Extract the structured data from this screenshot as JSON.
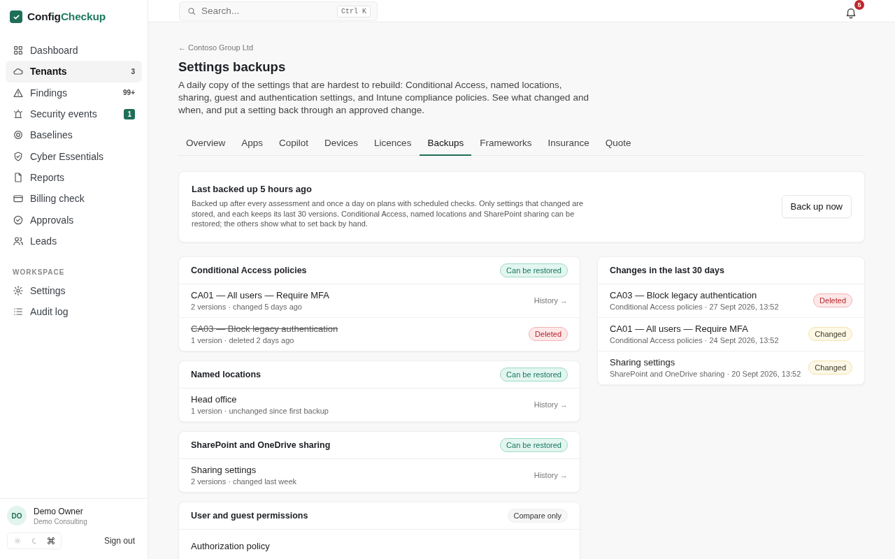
{
  "brand": {
    "first": "Config",
    "second": "Checkup"
  },
  "sidebar": {
    "items": [
      {
        "label": "Dashboard",
        "selected": false
      },
      {
        "label": "Tenants",
        "selected": true,
        "count": {
          "text": "3",
          "kind": "plain"
        }
      },
      {
        "label": "Findings",
        "selected": false,
        "count": {
          "text": "99+",
          "kind": "plain"
        }
      },
      {
        "label": "Security events",
        "selected": false,
        "count": {
          "text": "1",
          "kind": "accent"
        }
      },
      {
        "label": "Baselines",
        "selected": false
      },
      {
        "label": "Cyber Essentials",
        "selected": false
      },
      {
        "label": "Reports",
        "selected": false
      },
      {
        "label": "Billing check",
        "selected": false
      },
      {
        "label": "Approvals",
        "selected": false
      },
      {
        "label": "Leads",
        "selected": false
      }
    ],
    "section_title": "WORKSPACE",
    "workspace_items": [
      {
        "label": "Settings",
        "selected": false
      },
      {
        "label": "Audit log",
        "selected": false
      }
    ],
    "user": {
      "initials": "DO",
      "name": "Demo Owner",
      "org": "Demo Consulting"
    },
    "theme_options": [
      {
        "selected": false
      },
      {
        "selected": false
      },
      {
        "selected": true
      }
    ],
    "sign_out": "Sign out"
  },
  "topbar": {
    "search": {
      "placeholder": "Search...",
      "shortcut": "Ctrl K"
    },
    "notifications": "5"
  },
  "breadcrumb": "← Contoso Group Ltd",
  "title": "Settings backups",
  "description": "A daily copy of the settings that are hardest to rebuild: Conditional Access, named locations, sharing, guest and authentication settings, and Intune compliance policies. See what changed and when, and put a setting back through an approved change.",
  "tabs": [
    {
      "label": "Overview",
      "selected": false
    },
    {
      "label": "Apps",
      "selected": false
    },
    {
      "label": "Copilot",
      "selected": false
    },
    {
      "label": "Devices",
      "selected": false
    },
    {
      "label": "Licences",
      "selected": false
    },
    {
      "label": "Backups",
      "selected": true
    },
    {
      "label": "Frameworks",
      "selected": false
    },
    {
      "label": "Insurance",
      "selected": false
    },
    {
      "label": "Quote",
      "selected": false
    }
  ],
  "backup_status": {
    "title": "Last backed up 5 hours ago",
    "text": "Backed up after every assessment and once a day on plans with scheduled checks. Only settings that changed are stored, and each keeps its last 30 versions. Conditional Access, named locations and SharePoint sharing can be restored; the others show what to set back by hand.",
    "button": "Back up now"
  },
  "sections": [
    {
      "title": "Conditional Access policies",
      "badge": {
        "label": "Can be restored",
        "kind": "restorable"
      },
      "items": [
        {
          "title": "CA01 — All users — Require MFA",
          "meta": "2 versions · changed 5 days ago",
          "deleted": false,
          "link": "History →"
        },
        {
          "title": "CA03 — Block legacy authentication",
          "meta": "1 version · deleted 2 days ago",
          "deleted": true,
          "badge": {
            "label": "Deleted",
            "kind": "deleted"
          }
        }
      ]
    },
    {
      "title": "Named locations",
      "badge": {
        "label": "Can be restored",
        "kind": "restorable"
      },
      "items": [
        {
          "title": "Head office",
          "meta": "1 version · unchanged since first backup",
          "deleted": false,
          "link": "History →"
        }
      ]
    },
    {
      "title": "SharePoint and OneDrive sharing",
      "badge": {
        "label": "Can be restored",
        "kind": "restorable"
      },
      "items": [
        {
          "title": "Sharing settings",
          "meta": "2 versions · changed last week",
          "deleted": false,
          "link": "History →"
        }
      ]
    },
    {
      "title": "User and guest permissions",
      "badge": {
        "label": "Compare only",
        "kind": "compare"
      },
      "items": [
        {
          "title": "Authorization policy",
          "deleted": false
        }
      ]
    }
  ],
  "changes": {
    "title": "Changes in the last 30 days",
    "items": [
      {
        "title": "CA03 — Block legacy authentication",
        "meta": "Conditional Access policies · 27 Sept 2026, 13:52",
        "badge": {
          "label": "Deleted",
          "kind": "deleted"
        }
      },
      {
        "title": "CA01 — All users — Require MFA",
        "meta": "Conditional Access policies · 24 Sept 2026, 13:52",
        "badge": {
          "label": "Changed",
          "kind": "changed"
        }
      },
      {
        "title": "Sharing settings",
        "meta": "SharePoint and OneDrive sharing · 20 Sept 2026, 13:52",
        "badge": {
          "label": "Changed",
          "kind": "changed"
        }
      }
    ]
  }
}
